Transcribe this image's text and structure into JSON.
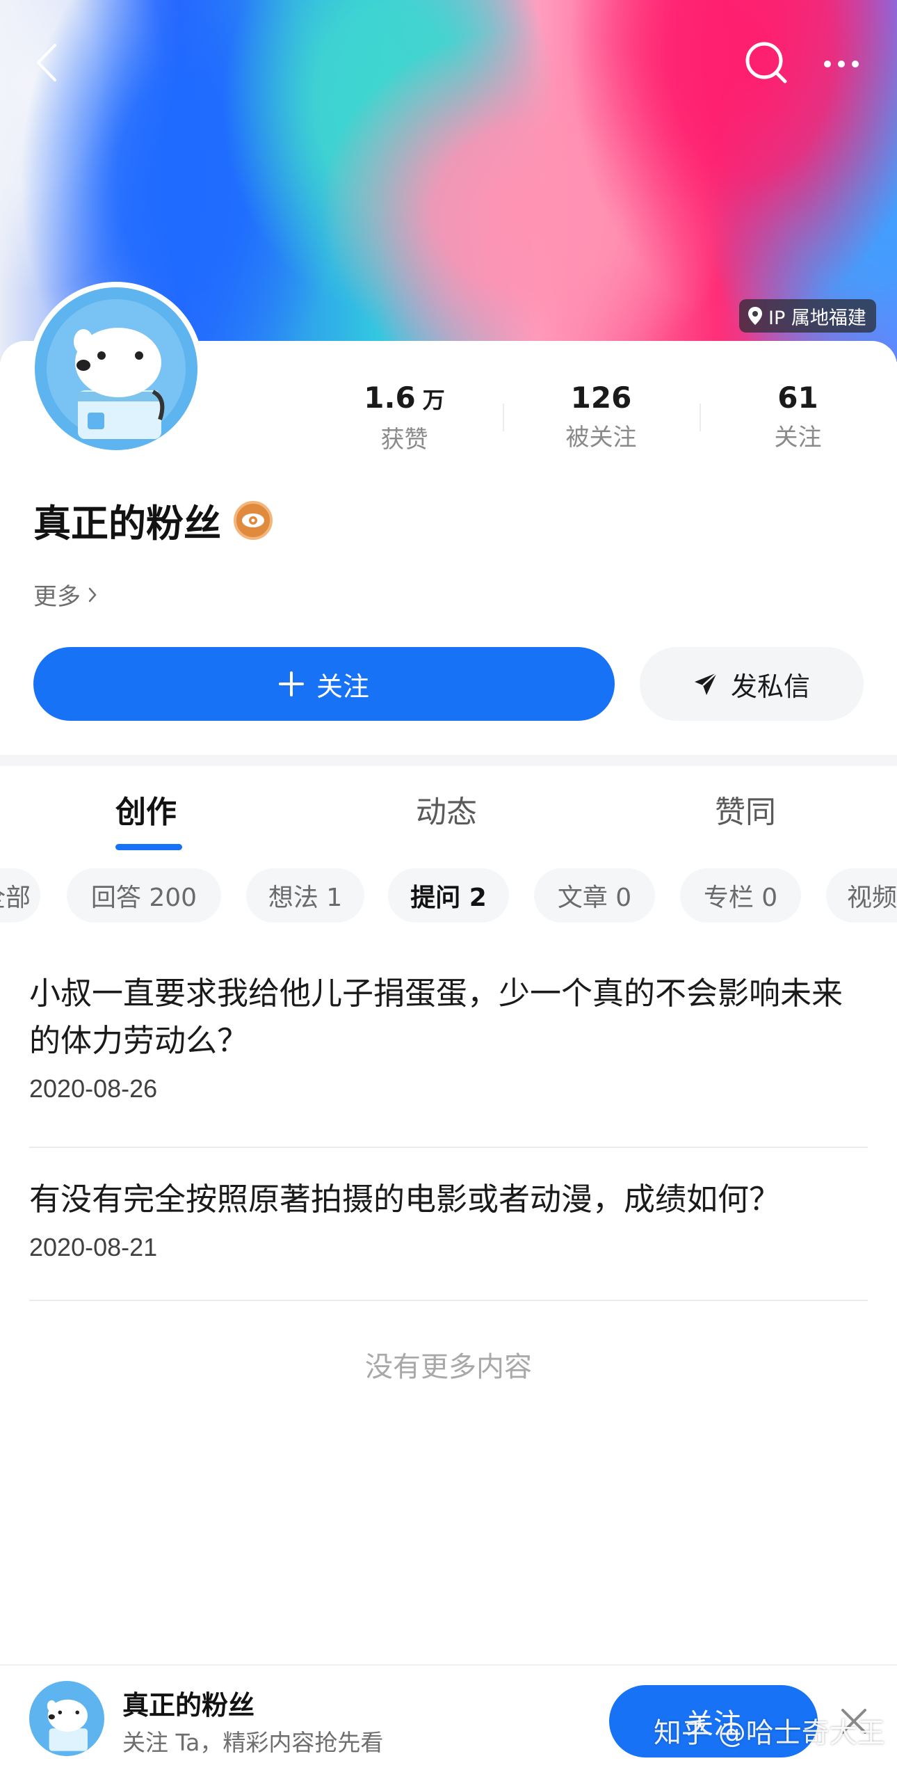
{
  "header": {
    "ip_location": "IP 属地福建",
    "icons": [
      "back-icon",
      "search-icon",
      "more-icon",
      "location-pin-icon"
    ]
  },
  "profile": {
    "name": "真正的粉丝",
    "more_link": "更多",
    "stats": [
      {
        "value": "1.6",
        "unit": "万",
        "label": "获赞"
      },
      {
        "value": "126",
        "unit": "",
        "label": "被关注"
      },
      {
        "value": "61",
        "unit": "",
        "label": "关注"
      }
    ],
    "follow_label": "关注",
    "message_label": "发私信"
  },
  "tabs": [
    {
      "label": "创作",
      "active": true
    },
    {
      "label": "动态",
      "active": false
    },
    {
      "label": "赞同",
      "active": false
    }
  ],
  "chips": [
    {
      "label": "全部"
    },
    {
      "label": "回答 200"
    },
    {
      "label": "想法 1"
    },
    {
      "label": "提问 2",
      "active": true
    },
    {
      "label": "文章 0"
    },
    {
      "label": "专栏 0"
    },
    {
      "label": "视频"
    }
  ],
  "questions": [
    {
      "title": "小叔一直要求我给他儿子捐蛋蛋，少一个真的不会影响未来的体力劳动么？",
      "date": "2020-08-26"
    },
    {
      "title": "有没有完全按照原著拍摄的电影或者动漫，成绩如何？",
      "date": "2020-08-21"
    }
  ],
  "no_more": "没有更多内容",
  "bottom_bar": {
    "name": "真正的粉丝",
    "subtitle": "关注 Ta，精彩内容抢先看",
    "follow_label": "关注"
  },
  "watermark": "知乎 @哈士奇大王",
  "colors": {
    "accent": "#1772f6"
  }
}
